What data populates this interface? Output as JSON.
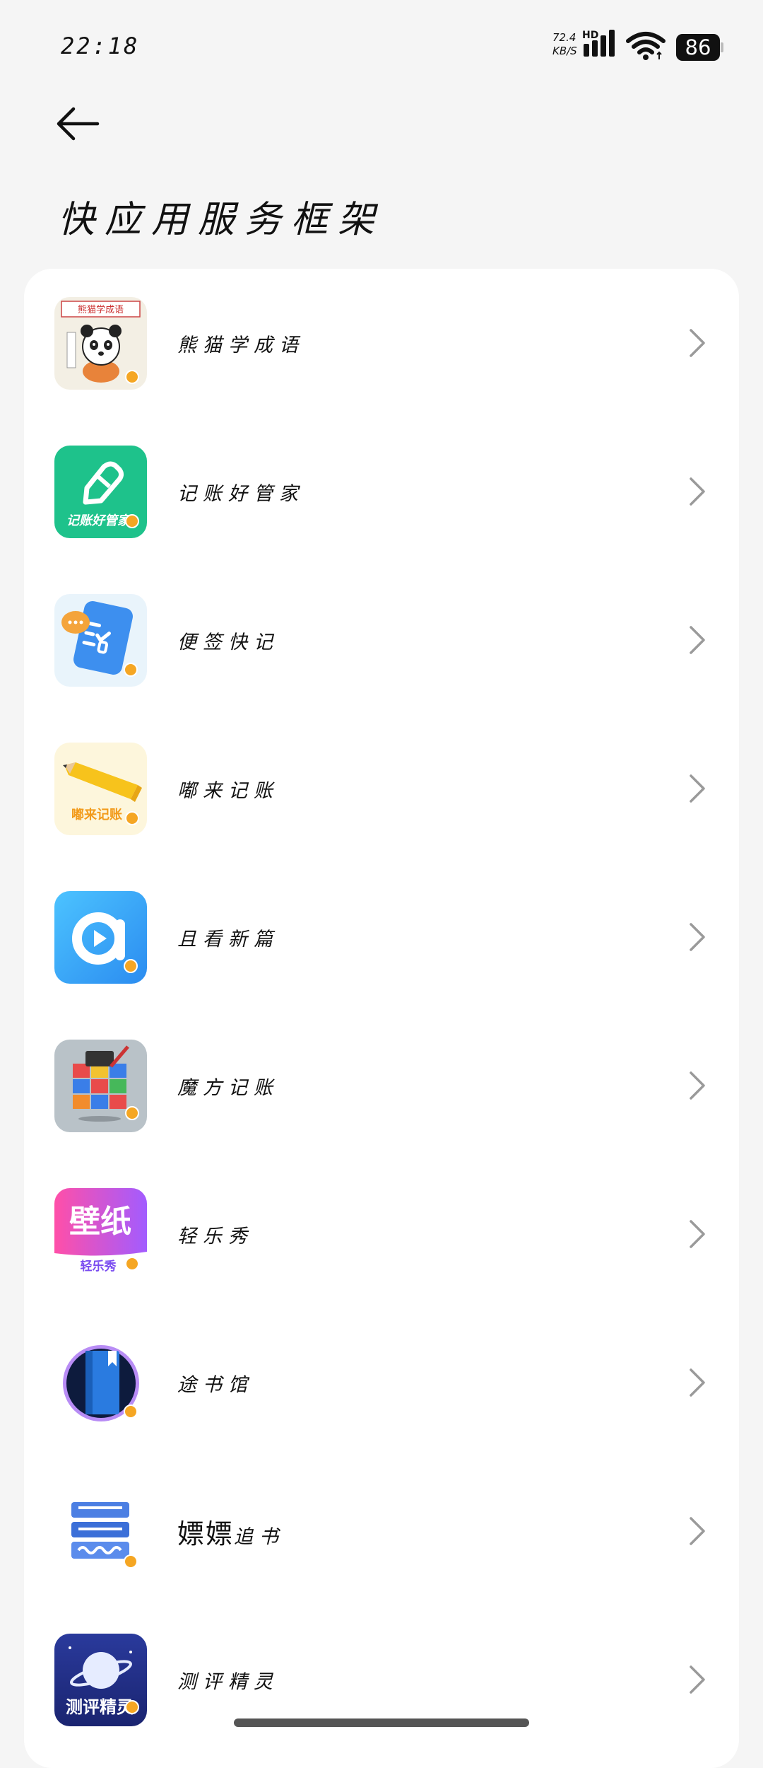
{
  "status_bar": {
    "time": "22:18",
    "net_speed_value": "72.4",
    "net_speed_unit": "KB/S",
    "network_type": "HD",
    "battery": "86"
  },
  "header": {
    "back_icon": "arrow-left-icon",
    "title": "快应用服务框架"
  },
  "apps": [
    {
      "name": "熊猫学成语",
      "icon": "panda-idiom-icon",
      "icon_text": "熊猫学成语"
    },
    {
      "name": "记账好管家",
      "icon": "pencil-ledger-icon",
      "icon_text": "记账好管家"
    },
    {
      "name": "便签快记",
      "icon": "notepad-icon",
      "icon_text": ""
    },
    {
      "name": "嘟来记账",
      "icon": "pencil-icon",
      "icon_text": "嘟来记账"
    },
    {
      "name": "且看新篇",
      "icon": "play-circle-icon",
      "icon_text": ""
    },
    {
      "name": "魔方记账",
      "icon": "rubiks-cube-icon",
      "icon_text": ""
    },
    {
      "name": "轻乐秀",
      "icon": "wallpaper-icon",
      "icon_text": "壁纸",
      "icon_subtext": "轻乐秀"
    },
    {
      "name": "途书馆",
      "icon": "book-circle-icon",
      "icon_text": ""
    },
    {
      "name_prefix": "嫖嫖",
      "name": "追书",
      "icon": "book-stack-icon",
      "icon_text": ""
    },
    {
      "name": "测评精灵",
      "icon": "planet-icon",
      "icon_text": "测评精灵"
    }
  ],
  "chevron_icon": "chevron-right-icon",
  "colors": {
    "background": "#f5f5f5",
    "card": "#ffffff",
    "chevron": "#9a9a9a",
    "badge": "#f5a623"
  }
}
